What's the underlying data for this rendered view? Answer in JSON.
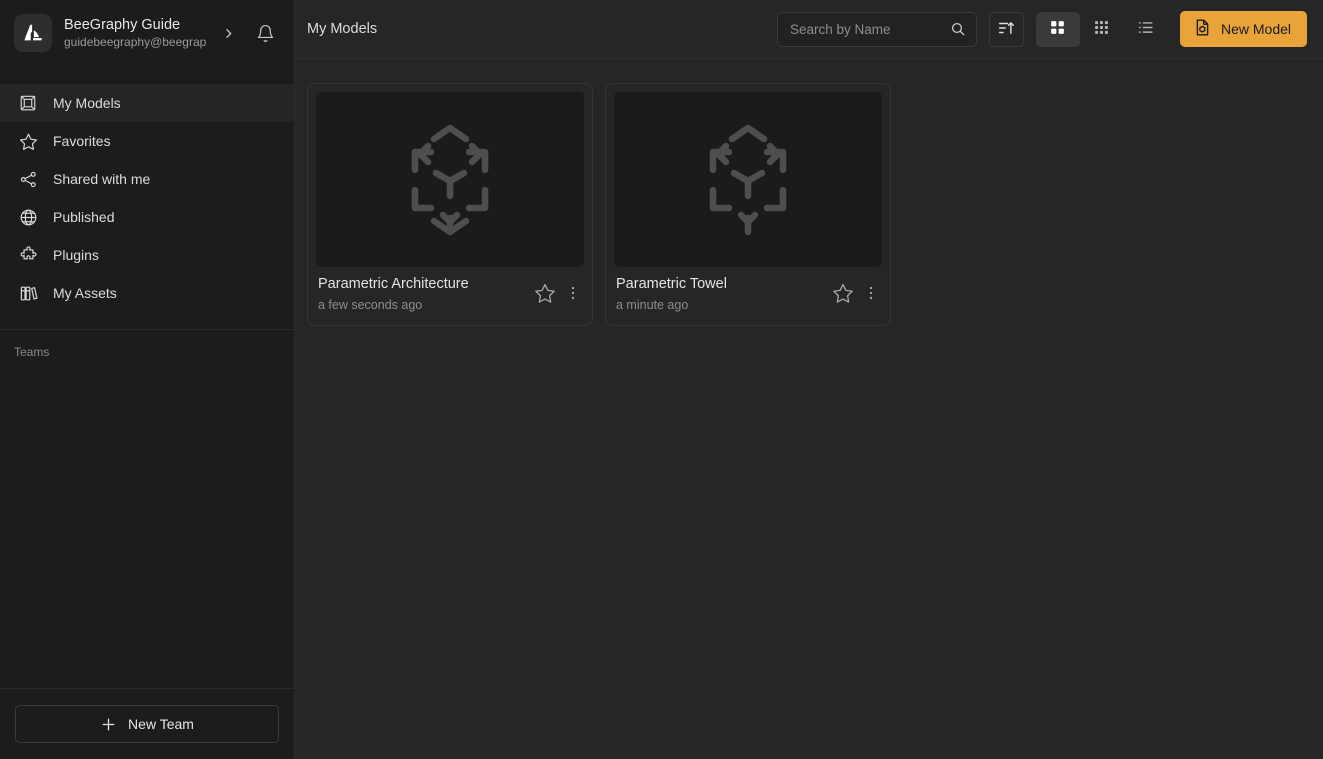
{
  "account": {
    "name": "BeeGraphy Guide",
    "email": "guidebeegraphy@beegrap",
    "logo_icon": "beegraphy-logo-icon",
    "chevron_icon": "chevron-right-icon",
    "bell_icon": "bell-icon"
  },
  "sidebar": {
    "items": [
      {
        "label": "My Models",
        "icon": "cube-frame-icon",
        "active": true
      },
      {
        "label": "Favorites",
        "icon": "star-icon",
        "active": false
      },
      {
        "label": "Shared with me",
        "icon": "share-nodes-icon",
        "active": false
      },
      {
        "label": "Published",
        "icon": "globe-icon",
        "active": false
      },
      {
        "label": "Plugins",
        "icon": "puzzle-piece-icon",
        "active": false
      },
      {
        "label": "My Assets",
        "icon": "books-icon",
        "active": false
      }
    ],
    "teams_label": "Teams",
    "new_team_label": "New Team",
    "new_team_icon": "plus-icon"
  },
  "topbar": {
    "title": "My Models",
    "search": {
      "placeholder": "Search by Name",
      "value": "",
      "icon": "search-icon"
    },
    "sort_icon": "sort-ascending-icon",
    "views": [
      {
        "name": "grid-large",
        "icon": "grid-2x2-icon",
        "active": true
      },
      {
        "name": "grid-small",
        "icon": "grid-3x3-icon",
        "active": false
      },
      {
        "name": "list",
        "icon": "list-icon",
        "active": false
      }
    ],
    "new_model_label": "New Model",
    "new_model_icon": "file-cube-icon"
  },
  "models": [
    {
      "title": "Parametric Architecture",
      "time": "a few seconds ago",
      "thumb_icon": "cube-placeholder-icon",
      "star_icon": "star-outline-icon",
      "menu_icon": "kebab-menu-icon"
    },
    {
      "title": "Parametric Towel",
      "time": "a minute ago",
      "thumb_icon": "cube-placeholder-icon",
      "star_icon": "star-outline-icon",
      "menu_icon": "kebab-menu-icon"
    }
  ],
  "colors": {
    "accent": "#e8a33a",
    "sidebar_bg": "#1c1c1c",
    "main_bg": "#262626",
    "thumb_bg": "#1b1b1b"
  }
}
